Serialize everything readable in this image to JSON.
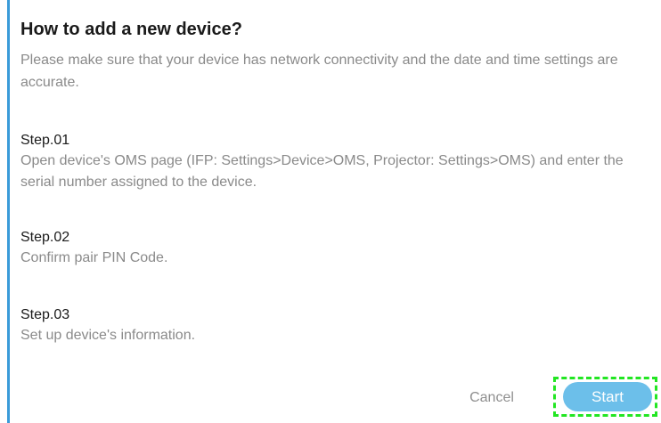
{
  "dialog": {
    "title": "How to add a new device?",
    "intro": "Please make sure that your device has network connectivity and the date and time settings are accurate.",
    "steps": [
      {
        "title": "Step.01",
        "description": "Open device's OMS page (IFP: Settings>Device>OMS, Projector: Settings>OMS) and enter the serial number assigned to the device."
      },
      {
        "title": "Step.02",
        "description": "Confirm pair PIN Code."
      },
      {
        "title": "Step.03",
        "description": "Set up device's information."
      }
    ],
    "cancel_label": "Cancel",
    "start_label": "Start"
  },
  "colors": {
    "accent": "#3a9bd9",
    "start_button": "#6cbfea",
    "highlight": "#22e622",
    "muted_text": "#8a8a8a"
  }
}
